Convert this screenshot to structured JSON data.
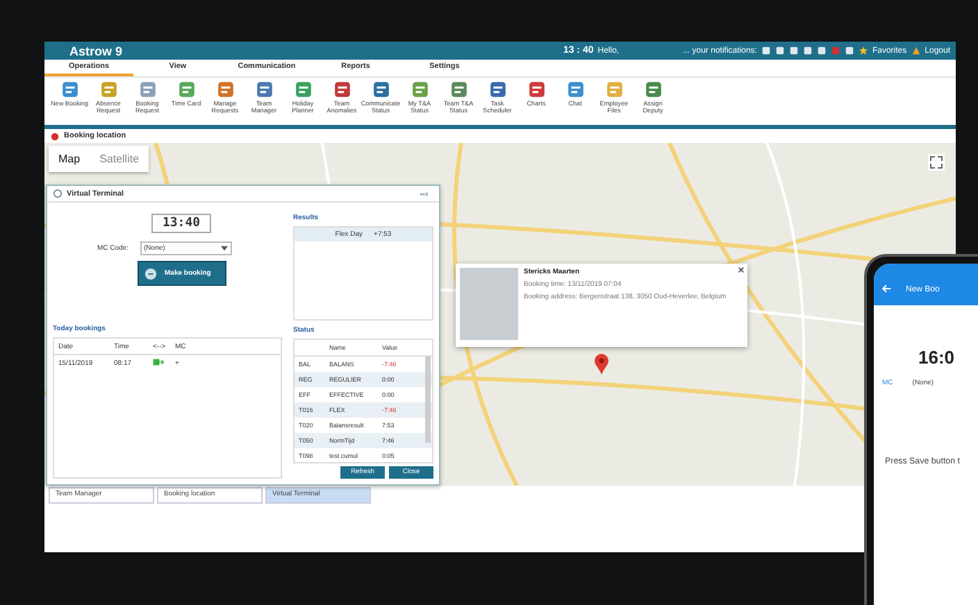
{
  "topbar": {
    "logo": "Astrow 9",
    "time": "13 : 40",
    "greeting": "Hello,",
    "notifications": "... your notifications:",
    "favorites": "Favorites",
    "logout": "Logout"
  },
  "menu_tabs": [
    {
      "label": "Operations",
      "selected": true
    },
    {
      "label": "View",
      "selected": false
    },
    {
      "label": "Communication",
      "selected": false
    },
    {
      "label": "Reports",
      "selected": false
    },
    {
      "label": "Settings",
      "selected": false
    }
  ],
  "toolbar": [
    "New Booking",
    "Absence Request",
    "Booking Request",
    "Time Card",
    "Manage Requests",
    "Team Manager",
    "Holiday Planner",
    "Team Anomalies",
    "Communicate Status",
    "My T&A Status",
    "Team T&A Status",
    "Task Scheduler",
    "Charts",
    "Chat",
    "Employee Files",
    "Assign Deputy"
  ],
  "window": {
    "title": "Booking location"
  },
  "map_toggle": [
    {
      "label": "Map",
      "selected": true
    },
    {
      "label": "Satellite",
      "selected": false
    }
  ],
  "virtual_terminal": {
    "title": "Virtual Terminal",
    "clock": "13:40",
    "mc_label": "MC Code:",
    "mc_value": "(None)",
    "button": "Make booking",
    "results": {
      "title": "Results",
      "rows": [
        {
          "name": "Flex Day",
          "value": "+7:53"
        }
      ]
    },
    "today_bookings": {
      "title": "Today bookings",
      "columns": [
        "Date",
        "Time",
        "<-->",
        "MC"
      ],
      "rows": [
        {
          "date": "15/11/2019",
          "time": "08:17",
          "mc": "+"
        }
      ]
    },
    "status": {
      "title": "Status",
      "columns": [
        "Name",
        "Value"
      ],
      "rows": [
        {
          "code": "BAL",
          "name": "BALANS",
          "value": "-7:46",
          "negative": true
        },
        {
          "code": "REG",
          "name": "REGULIER",
          "value": "0:00",
          "negative": false
        },
        {
          "code": "EFF",
          "name": "EFFECTIVE",
          "value": "0:00",
          "negative": false
        },
        {
          "code": "T016",
          "name": "FLEX",
          "value": "-7:46",
          "negative": true
        },
        {
          "code": "T020",
          "name": "Balansresult",
          "value": "7:53",
          "negative": false
        },
        {
          "code": "T050",
          "name": "NormTijd",
          "value": "7:46",
          "negative": false
        },
        {
          "code": "T098",
          "name": "test cumul",
          "value": "0:05",
          "negative": false
        }
      ]
    },
    "buttons": [
      "Refresh",
      "Close"
    ]
  },
  "popup": {
    "name": "Stericks Maarten",
    "booking_time": "Booking time: 13/11/2019 07:04",
    "address": "Booking address: Bergenstraat 138, 3050 Oud-Heverlee, Belgium"
  },
  "taskbar": [
    {
      "label": "Team Manager",
      "selected": false
    },
    {
      "label": "Booking location",
      "selected": false
    },
    {
      "label": "Virtual Terminal",
      "selected": true
    }
  ],
  "phone": {
    "title": "New Boo",
    "clock": "16:0",
    "mc_label": "MC",
    "mc_value": "(None)",
    "message": "Press Save button t"
  }
}
